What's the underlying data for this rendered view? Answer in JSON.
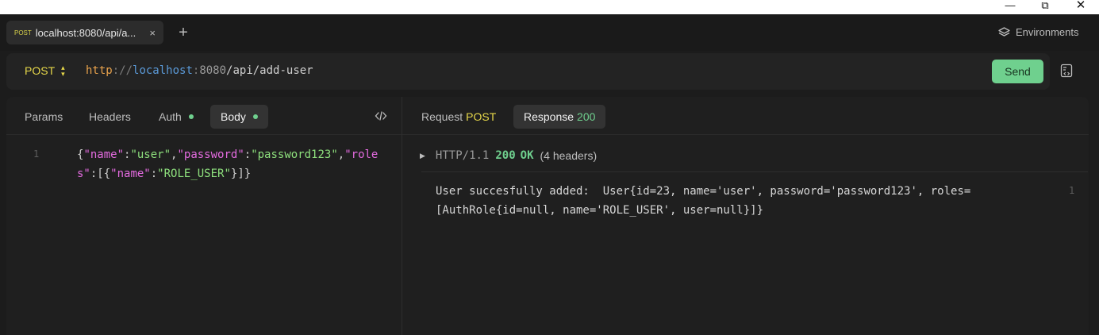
{
  "window": {
    "minimize": "—",
    "maximize": "⧉",
    "close": "✕"
  },
  "tab": {
    "method": "POST",
    "title": "localhost:8080/api/a...",
    "close": "×"
  },
  "new_tab": "+",
  "environments": "Environments",
  "request": {
    "method": "POST",
    "url": {
      "scheme": "http",
      "sep1": "://",
      "host": "localhost",
      "sep2": ":",
      "port": "8080",
      "path": "/api/add-user"
    }
  },
  "send_label": "Send",
  "request_tabs": {
    "params": "Params",
    "headers": "Headers",
    "auth": "Auth",
    "body": "Body"
  },
  "editor": {
    "line_number": "1",
    "tokens": [
      {
        "t": "p",
        "v": "{"
      },
      {
        "t": "k",
        "v": "\"name\""
      },
      {
        "t": "p",
        "v": ":"
      },
      {
        "t": "s",
        "v": "\"user\""
      },
      {
        "t": "p",
        "v": ","
      },
      {
        "t": "k",
        "v": "\"password\""
      },
      {
        "t": "p",
        "v": ":"
      },
      {
        "t": "s",
        "v": "\"password123\""
      },
      {
        "t": "p",
        "v": ","
      },
      {
        "t": "k",
        "v": "\"roles\""
      },
      {
        "t": "p",
        "v": ":[{"
      },
      {
        "t": "k",
        "v": "\"name\""
      },
      {
        "t": "p",
        "v": ":"
      },
      {
        "t": "s",
        "v": "\"ROLE_USER\""
      },
      {
        "t": "p",
        "v": "}]}"
      }
    ]
  },
  "response_tabs": {
    "request_label": "Request",
    "request_method": "POST",
    "response_label": "Response",
    "response_code": "200"
  },
  "response": {
    "protocol": "HTTP/1.1",
    "status_code": "200",
    "status_text": "OK",
    "headers_count": "(4 headers)",
    "line_number": "1",
    "body": "User succesfully added:  User{id=23, name='user', password='password123', roles=[AuthRole{id=null, name='ROLE_USER', user=null}]}"
  },
  "colors": {
    "accent_green": "#6fd08e",
    "method_yellow": "#e7d84a",
    "json_key": "#e46be0",
    "json_string": "#8ee07d"
  }
}
